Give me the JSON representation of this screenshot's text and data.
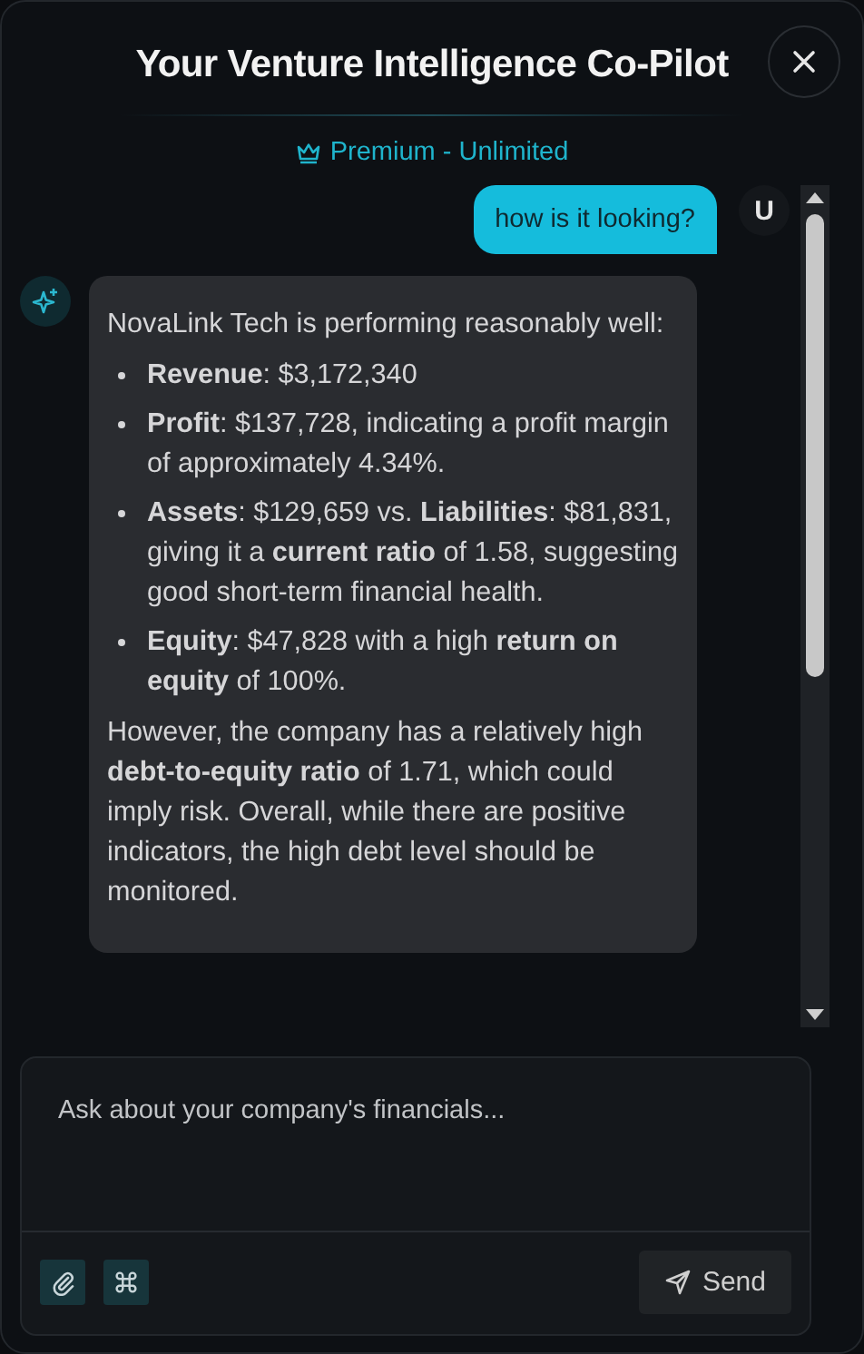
{
  "header": {
    "title": "Your Venture Intelligence Co-Pilot",
    "plan": "Premium - Unlimited"
  },
  "messages": [
    {
      "kind": "user",
      "avatar": "U",
      "text": "how is it looking?"
    },
    {
      "kind": "assistant",
      "blocks": [
        {
          "kind": "paragraph",
          "text": "NovaLink Tech is performing reasonably well:"
        },
        {
          "kind": "list",
          "items": [
            "**Revenue**: $3,172,340",
            "**Profit**: $137,728, indicating a profit margin of approximately 4.34%.",
            "**Assets**: $129,659 vs. **Liabilities**: $81,831, giving it a **current ratio** of 1.58, suggesting good short-term financial health.",
            "**Equity**: $47,828 with a high **return on equity** of 100%."
          ]
        },
        {
          "kind": "paragraph",
          "text": "However, the company has a relatively high **debt-to-equity ratio** of 1.71, which could imply risk. Overall, while there are positive indicators, the high debt level should be monitored."
        }
      ]
    }
  ],
  "composer": {
    "placeholder": "Ask about your company's financials...",
    "send": "Send"
  }
}
